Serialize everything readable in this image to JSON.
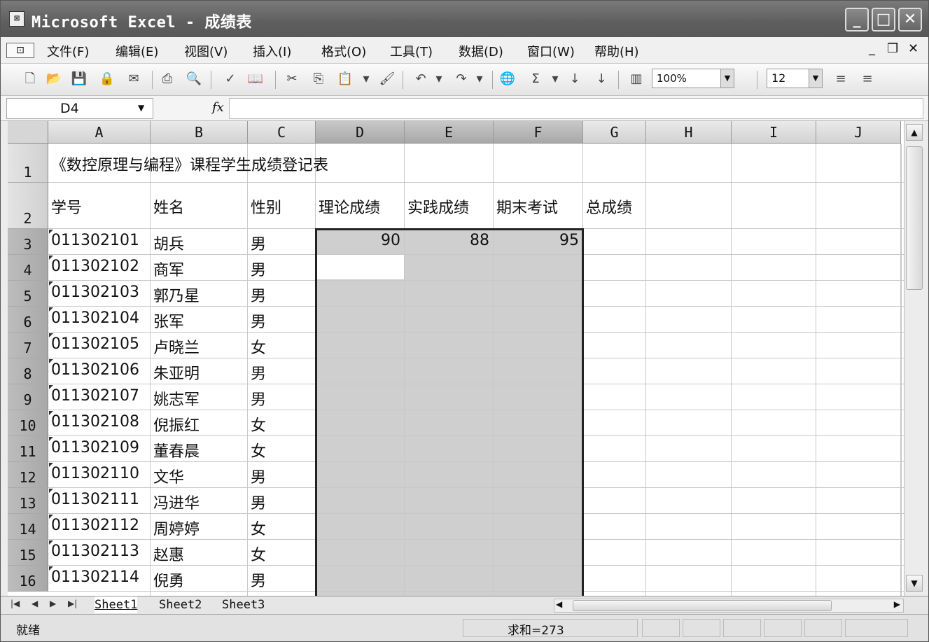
{
  "window": {
    "title": "Microsoft Excel - 成绩表",
    "icon_glyph": "⊠"
  },
  "menu": {
    "items": [
      "文件(F)",
      "编辑(E)",
      "视图(V)",
      "插入(I)",
      "格式(O)",
      "工具(T)",
      "数据(D)",
      "窗口(W)",
      "帮助(H)"
    ],
    "grip_glyph": "⊡"
  },
  "toolbar": {
    "zoom": "100%",
    "font_size": "12"
  },
  "formula_bar": {
    "name_box": "D4",
    "fx_label": "fx",
    "formula": ""
  },
  "grid": {
    "columns": [
      "A",
      "B",
      "C",
      "D",
      "E",
      "F",
      "G",
      "H",
      "I",
      "J"
    ],
    "selected_columns": [
      "D",
      "E",
      "F"
    ],
    "row_numbers": [
      "1",
      "2",
      "3",
      "4",
      "5",
      "6",
      "7",
      "8",
      "9",
      "10",
      "11",
      "12",
      "13",
      "14",
      "15",
      "16"
    ],
    "selected_rows": [
      "3",
      "4",
      "5",
      "6",
      "7",
      "8",
      "9",
      "10",
      "11",
      "12",
      "13",
      "14",
      "15",
      "16"
    ],
    "title": "《数控原理与编程》课程学生成绩登记表",
    "headers": [
      "学号",
      "姓名",
      "性别",
      "理论成绩",
      "实践成绩",
      "期末考试",
      "总成绩"
    ],
    "students": [
      {
        "id": "011302101",
        "name": "胡兵",
        "gender": "男",
        "theory": "90",
        "practice": "88",
        "final": "95"
      },
      {
        "id": "011302102",
        "name": "商军",
        "gender": "男",
        "theory": "",
        "practice": "",
        "final": ""
      },
      {
        "id": "011302103",
        "name": "郭乃星",
        "gender": "男",
        "theory": "",
        "practice": "",
        "final": ""
      },
      {
        "id": "011302104",
        "name": "张军",
        "gender": "男",
        "theory": "",
        "practice": "",
        "final": ""
      },
      {
        "id": "011302105",
        "name": "卢晓兰",
        "gender": "女",
        "theory": "",
        "practice": "",
        "final": ""
      },
      {
        "id": "011302106",
        "name": "朱亚明",
        "gender": "男",
        "theory": "",
        "practice": "",
        "final": ""
      },
      {
        "id": "011302107",
        "name": "姚志军",
        "gender": "男",
        "theory": "",
        "practice": "",
        "final": ""
      },
      {
        "id": "011302108",
        "name": "倪振红",
        "gender": "女",
        "theory": "",
        "practice": "",
        "final": ""
      },
      {
        "id": "011302109",
        "name": "董春晨",
        "gender": "女",
        "theory": "",
        "practice": "",
        "final": ""
      },
      {
        "id": "011302110",
        "name": "文华",
        "gender": "男",
        "theory": "",
        "practice": "",
        "final": ""
      },
      {
        "id": "011302111",
        "name": "冯进华",
        "gender": "男",
        "theory": "",
        "practice": "",
        "final": ""
      },
      {
        "id": "011302112",
        "name": "周婷婷",
        "gender": "女",
        "theory": "",
        "practice": "",
        "final": ""
      },
      {
        "id": "011302113",
        "name": "赵惠",
        "gender": "女",
        "theory": "",
        "practice": "",
        "final": ""
      },
      {
        "id": "011302114",
        "name": "倪勇",
        "gender": "男",
        "theory": "",
        "practice": "",
        "final": ""
      }
    ]
  },
  "sheets": {
    "tabs": [
      "Sheet1",
      "Sheet2",
      "Sheet3"
    ],
    "active": "Sheet1"
  },
  "status": {
    "ready": "就绪",
    "sum": "求和=273"
  },
  "colors": {
    "selection_fill": "#cfcfcf",
    "title_bar": "#5e5e5e"
  }
}
